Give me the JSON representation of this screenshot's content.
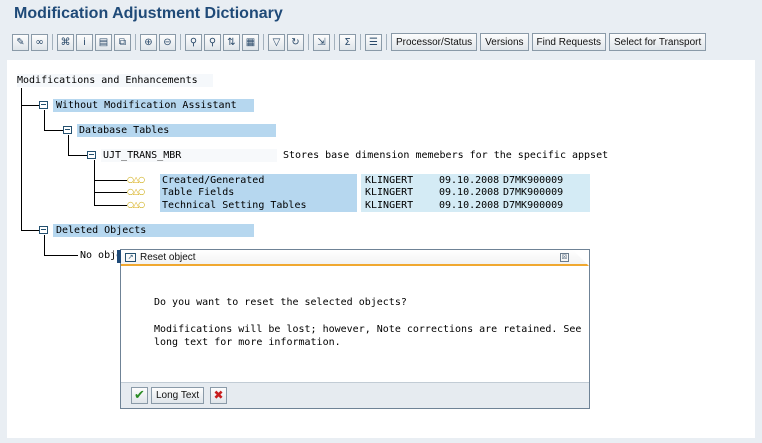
{
  "app": {
    "title": "Modification Adjustment Dictionary"
  },
  "toolbar": {
    "icons": [
      "pencil-icon",
      "glasses-icon",
      "choose-icon",
      "info-icon",
      "print-icon",
      "copy-icon",
      "expand-icon",
      "collapse-icon",
      "find-icon",
      "find-next-icon",
      "sort-icon",
      "detail-icon",
      "filter-icon",
      "refresh-icon",
      "export-icon",
      "sum-icon",
      "layout-icon"
    ],
    "buttons": {
      "processor_status": "Processor/Status",
      "versions": "Versions",
      "find_requests": "Find Requests",
      "select_for_transport": "Select for Transport"
    }
  },
  "tree": {
    "root": "Modifications and Enhancements",
    "without_mod_assistant": "Without Modification Assistant",
    "database_tables": "Database Tables",
    "table": {
      "name": "UJT_TRANS_MBR",
      "description": "Stores base dimension memebers for the specific appset"
    },
    "entries": [
      {
        "label": "Created/Generated",
        "user": "KLINGERT",
        "date": "09.10.2008",
        "request": "D7MK900009",
        "status": "ᴏ△ᴏ"
      },
      {
        "label": "Table Fields",
        "user": "KLINGERT",
        "date": "09.10.2008",
        "request": "D7MK900009",
        "status": "ᴏ△ᴏ"
      },
      {
        "label": "Technical Setting Tables",
        "user": "KLINGERT",
        "date": "09.10.2008",
        "request": "D7MK900009",
        "status": "ᴏ△ᴏ"
      }
    ],
    "deleted_objects": "Deleted Objects",
    "no_objects_partial": "No obje"
  },
  "dialog": {
    "title": "Reset object",
    "line1": "Do you want to reset the selected objects?",
    "line2": "Modifications will be lost; however, Note corrections are retained. See",
    "line3": "long text for more information.",
    "long_text_label": "Long Text",
    "ok_glyph": "✔",
    "cancel_glyph": "✖",
    "close_glyph": "⊠"
  },
  "colors": {
    "title": "#1f4a78",
    "highlight": "#b6d7ef",
    "dialog_accent": "#f0a830"
  }
}
